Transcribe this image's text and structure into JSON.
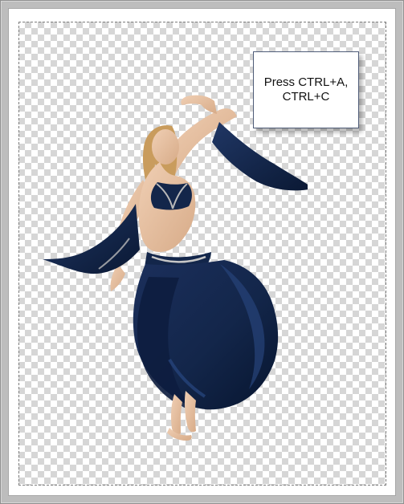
{
  "canvas": {
    "instruction": {
      "line1": "Press CTRL+A,",
      "line2": "CTRL+C"
    },
    "colors": {
      "frame": "#bdbdbd",
      "checker_light": "#ffffff",
      "checker_dark": "#d6d6d6",
      "costume": "#13264a",
      "costume_shadow": "#07152f",
      "skin": "#e7c0a1",
      "hair": "#c99c5d",
      "trim": "#c7c7c7"
    },
    "icons": {
      "dancer": "dancer-icon"
    }
  }
}
